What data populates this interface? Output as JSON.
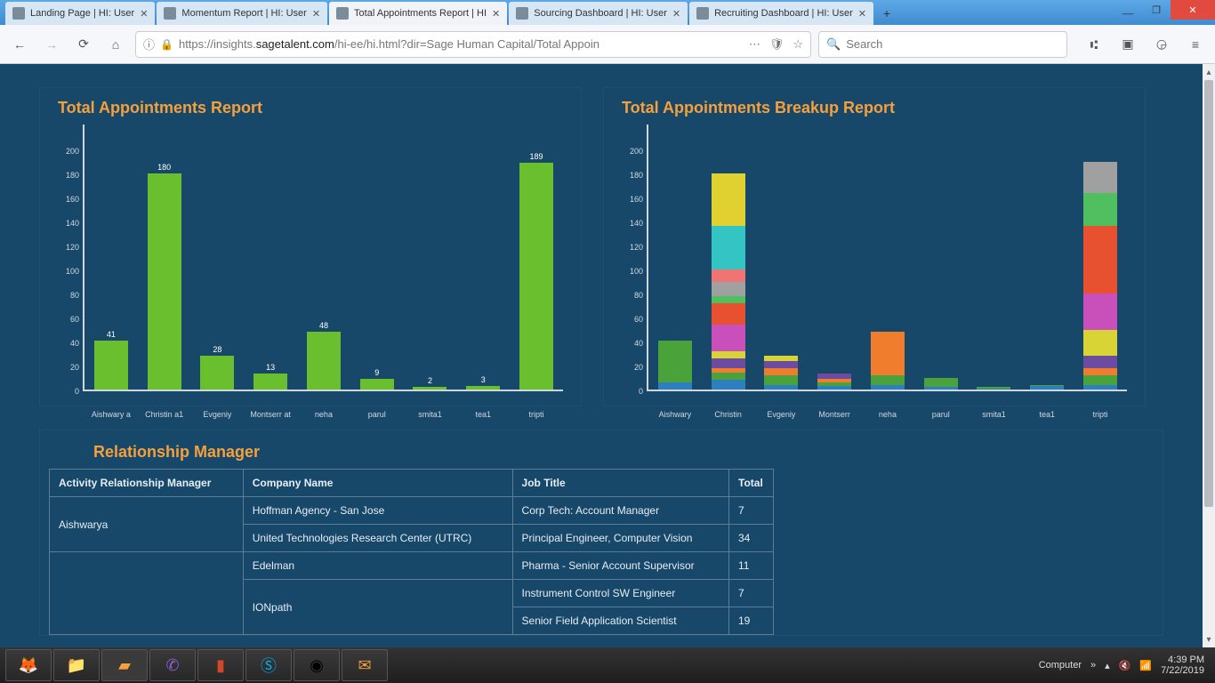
{
  "browser": {
    "tabs": [
      {
        "title": "Landing Page | HI: User",
        "active": false
      },
      {
        "title": "Momentum Report | HI: User",
        "active": false
      },
      {
        "title": "Total Appointments Report | HI",
        "active": true
      },
      {
        "title": "Sourcing Dashboard | HI: User",
        "active": false
      },
      {
        "title": "Recruiting Dashboard | HI: User",
        "active": false
      }
    ],
    "url_prefix": "https://insights.",
    "url_host": "sagetalent.com",
    "url_path": "/hi-ee/hi.html?dir=Sage Human Capital/Total Appoin",
    "search_placeholder": "Search"
  },
  "chart_data": [
    {
      "type": "bar",
      "title": "Total Appointments Report",
      "ylim": [
        0,
        200
      ],
      "yticks": [
        0,
        20,
        40,
        60,
        80,
        100,
        120,
        140,
        160,
        180,
        200
      ],
      "categories": [
        "Aishwarya",
        "Christina1",
        "Evgeniy",
        "Montserrat",
        "neha",
        "parul",
        "smita1",
        "tea1",
        "tripti"
      ],
      "values": [
        41,
        180,
        28,
        13,
        48,
        9,
        2,
        3,
        189
      ]
    },
    {
      "type": "stacked-bar",
      "title": "Total Appointments Breakup Report",
      "ylim": [
        0,
        200
      ],
      "yticks": [
        0,
        20,
        40,
        60,
        80,
        100,
        120,
        140,
        160,
        180,
        200
      ],
      "categories": [
        "Aishwarya",
        "Christina1",
        "Evgeniy",
        "Montserrat",
        "neha",
        "parul",
        "smita1",
        "tea1",
        "tripti"
      ],
      "series_colors": [
        "#2e7fc0",
        "#4aa33a",
        "#f07c2e",
        "#6b4ca0",
        "#d8d435",
        "#c94fbb",
        "#e8512f",
        "#4fbf60",
        "#a0a0a0",
        "#f07474",
        "#35c4c4",
        "#e0d030",
        "#b5e050",
        "#f5a03c"
      ],
      "stacks": [
        [
          6,
          35
        ],
        [
          8,
          6,
          4,
          8,
          6,
          22,
          18,
          6,
          12,
          10,
          36,
          44
        ],
        [
          4,
          8,
          6,
          6,
          4
        ],
        [
          3,
          3,
          3,
          4
        ],
        [
          4,
          8,
          36
        ],
        [
          2,
          8
        ],
        [
          1,
          1
        ],
        [
          3,
          1
        ],
        [
          4,
          8,
          6,
          10,
          22,
          30,
          56,
          28,
          26
        ]
      ]
    }
  ],
  "table": {
    "title": "Relationship Manager",
    "headers": [
      "Activity Relationship Manager",
      "Company Name",
      "Job Title",
      "Total"
    ],
    "groups": [
      {
        "manager": "Aishwarya",
        "rows": [
          {
            "company": "Hoffman Agency - San Jose",
            "job": "Corp Tech: Account Manager",
            "total": "7"
          },
          {
            "company": "United Technologies Research Center (UTRC)",
            "job": "Principal Engineer, Computer Vision",
            "total": "34"
          }
        ]
      },
      {
        "manager": "",
        "rows": [
          {
            "company": "Edelman",
            "job": "Pharma - Senior Account Supervisor",
            "total": "11"
          },
          {
            "company": "IONpath",
            "job": "Instrument Control SW Engineer",
            "total": "7"
          },
          {
            "company": "",
            "job": "Senior Field Application Scientist",
            "total": "19"
          }
        ]
      }
    ]
  },
  "taskbar": {
    "label": "Computer",
    "time": "4:39 PM",
    "date": "7/22/2019"
  }
}
